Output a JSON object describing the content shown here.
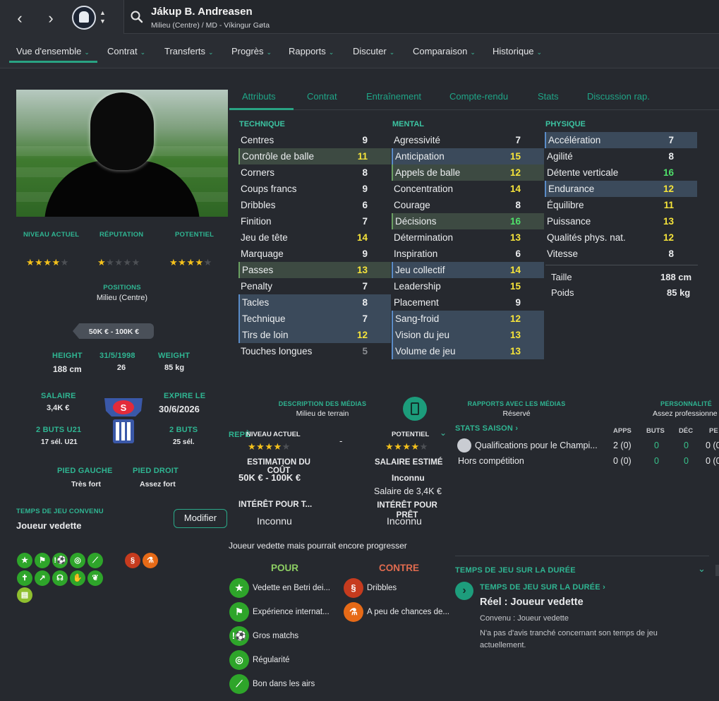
{
  "header": {
    "player_name": "Jákup B. Andreasen",
    "player_sub": "Milieu (Centre) / MD - Víkingur Gøta",
    "back_icon": "chevron-left-icon",
    "forward_icon": "chevron-right-icon"
  },
  "main_tabs": [
    {
      "label": "Vue d'ensemble"
    },
    {
      "label": "Contrat"
    },
    {
      "label": "Transferts"
    },
    {
      "label": "Progrès"
    },
    {
      "label": "Rapports"
    },
    {
      "label": "Discuter"
    },
    {
      "label": "Comparaison"
    },
    {
      "label": "Historique"
    }
  ],
  "profile": {
    "niveau_actuel_label": "NIVEAU ACTUEL",
    "reputation_label": "RÉPUTATION",
    "potentiel_label": "POTENTIEL",
    "niveau_actuel_stars": 4,
    "reputation_stars": 1,
    "potentiel_stars": 4,
    "positions_label": "POSITIONS",
    "positions_value": "Milieu (Centre)",
    "value_range": "50K € - 100K €",
    "height_label": "HEIGHT",
    "height_value": "188 cm",
    "dob_label": "31/5/1998",
    "age_value": "26",
    "weight_label": "WEIGHT",
    "weight_value": "85 kg",
    "salaire_label": "SALAIRE",
    "salaire_value": "3,4K €",
    "expire_label": "EXPIRE LE",
    "expire_value": "30/6/2026",
    "u21_label": "2 BUTS U21",
    "u21_value": "17 sél. U21",
    "buts_label": "2 BUTS",
    "buts_value": "25 sél.",
    "pied_gauche_label": "PIED GAUCHE",
    "pied_gauche_value": "Très fort",
    "pied_droit_label": "PIED DROIT",
    "pied_droit_value": "Assez fort",
    "temps_label": "TEMPS DE JEU CONVENU",
    "temps_value": "Joueur vedette",
    "modifier_label": "Modifier"
  },
  "sub_tabs": [
    {
      "label": "Attributs"
    },
    {
      "label": "Contrat"
    },
    {
      "label": "Entraînement"
    },
    {
      "label": "Compte-rendu"
    },
    {
      "label": "Stats"
    },
    {
      "label": "Discussion rap."
    }
  ],
  "attributes": {
    "technique_header": "TECHNIQUE",
    "mental_header": "MENTAL",
    "physique_header": "PHYSIQUE",
    "technique": [
      {
        "name": "Centres",
        "value": "9",
        "hl": "",
        "vc": "white"
      },
      {
        "name": "Contrôle de balle",
        "value": "11",
        "hl": "green",
        "vc": "yellow"
      },
      {
        "name": "Corners",
        "value": "8",
        "hl": "",
        "vc": "white"
      },
      {
        "name": "Coups francs",
        "value": "9",
        "hl": "",
        "vc": "white"
      },
      {
        "name": "Dribbles",
        "value": "6",
        "hl": "",
        "vc": "white"
      },
      {
        "name": "Finition",
        "value": "7",
        "hl": "",
        "vc": "white"
      },
      {
        "name": "Jeu de tête",
        "value": "14",
        "hl": "",
        "vc": "yellow"
      },
      {
        "name": "Marquage",
        "value": "9",
        "hl": "",
        "vc": "white"
      },
      {
        "name": "Passes",
        "value": "13",
        "hl": "green",
        "vc": "yellow"
      },
      {
        "name": "Penalty",
        "value": "7",
        "hl": "",
        "vc": "white"
      },
      {
        "name": "Tacles",
        "value": "8",
        "hl": "blue",
        "vc": "white"
      },
      {
        "name": "Technique",
        "value": "7",
        "hl": "blue",
        "vc": "white"
      },
      {
        "name": "Tirs de loin",
        "value": "12",
        "hl": "blue",
        "vc": "yellow"
      },
      {
        "name": "Touches longues",
        "value": "5",
        "hl": "",
        "vc": "grey"
      }
    ],
    "mental": [
      {
        "name": "Agressivité",
        "value": "7",
        "hl": "",
        "vc": "white"
      },
      {
        "name": "Anticipation",
        "value": "15",
        "hl": "blue",
        "vc": "yellow"
      },
      {
        "name": "Appels de balle",
        "value": "12",
        "hl": "green",
        "vc": "yellow"
      },
      {
        "name": "Concentration",
        "value": "14",
        "hl": "",
        "vc": "yellow"
      },
      {
        "name": "Courage",
        "value": "8",
        "hl": "",
        "vc": "white"
      },
      {
        "name": "Décisions",
        "value": "16",
        "hl": "green",
        "vc": "green"
      },
      {
        "name": "Détermination",
        "value": "13",
        "hl": "",
        "vc": "yellow"
      },
      {
        "name": "Inspiration",
        "value": "6",
        "hl": "",
        "vc": "white"
      },
      {
        "name": "Jeu collectif",
        "value": "14",
        "hl": "blue",
        "vc": "yellow"
      },
      {
        "name": "Leadership",
        "value": "15",
        "hl": "",
        "vc": "yellow"
      },
      {
        "name": "Placement",
        "value": "9",
        "hl": "",
        "vc": "white"
      },
      {
        "name": "Sang-froid",
        "value": "12",
        "hl": "blue",
        "vc": "yellow"
      },
      {
        "name": "Vision du jeu",
        "value": "13",
        "hl": "blue",
        "vc": "yellow"
      },
      {
        "name": "Volume de jeu",
        "value": "13",
        "hl": "blue",
        "vc": "yellow"
      }
    ],
    "physique": [
      {
        "name": "Accélération",
        "value": "7",
        "hl": "blue",
        "vc": "white"
      },
      {
        "name": "Agilité",
        "value": "8",
        "hl": "",
        "vc": "white"
      },
      {
        "name": "Détente verticale",
        "value": "16",
        "hl": "",
        "vc": "green"
      },
      {
        "name": "Endurance",
        "value": "12",
        "hl": "blue",
        "vc": "yellow"
      },
      {
        "name": "Équilibre",
        "value": "11",
        "hl": "",
        "vc": "yellow"
      },
      {
        "name": "Puissance",
        "value": "13",
        "hl": "",
        "vc": "yellow"
      },
      {
        "name": "Qualités phys. nat.",
        "value": "12",
        "hl": "",
        "vc": "yellow"
      },
      {
        "name": "Vitesse",
        "value": "8",
        "hl": "",
        "vc": "white"
      }
    ],
    "taille_label": "Taille",
    "taille_value": "188 cm",
    "poids_label": "Poids",
    "poids_value": "85 kg"
  },
  "media": {
    "desc_label": "DESCRIPTION DES MÉDIAS",
    "desc_value": "Milieu de terrain",
    "rapports_label": "RAPPORTS AVEC LES MÉDIAS",
    "rapports_value": "Réservé",
    "perso_label": "PERSONNALITÉ",
    "perso_value": "Assez professionne"
  },
  "report": {
    "repere_partial": "REPÈ",
    "niveau_label": "NIVEAU ACTUEL",
    "potentiel_label": "POTENTIEL",
    "niveau_stars": 4,
    "potentiel_stars": 4,
    "dash": "-",
    "estimation_label": "ESTIMATION DU COÛT",
    "estimation_value": "50K € - 100K €",
    "salaire_label": "SALAIRE ESTIMÉ",
    "salaire_value1": "Inconnu",
    "salaire_value2": "Salaire de 3,4K €",
    "interet_transfert_label": "INTÉRÊT POUR T...",
    "interet_transfert_value": "Inconnu",
    "interet_pret_label": "INTÉRÊT POUR PRÊT",
    "interet_pret_value": "Inconnu",
    "summary": "Joueur vedette mais pourrait encore progresser",
    "pour_label": "POUR",
    "contre_label": "CONTRE",
    "pour_items": [
      {
        "label": "Vedette en Betri dei...",
        "icon": "star-icon"
      },
      {
        "label": "Expérience internat...",
        "icon": "flag-icon"
      },
      {
        "label": "Gros matchs",
        "icon": "ball-exclaim-icon"
      },
      {
        "label": "Régularité",
        "icon": "target-icon"
      },
      {
        "label": "Bon dans les airs",
        "icon": "bandage-icon"
      }
    ],
    "contre_items": [
      {
        "label": "Dribbles",
        "icon": "dribble-icon"
      },
      {
        "label": "A peu de chances de...",
        "icon": "flask-icon"
      }
    ]
  },
  "stats": {
    "title": "STATS SAISON",
    "col_apps": "APPS",
    "col_buts": "BUTS",
    "col_dec": "DÉC",
    "col_pe": "PE",
    "rows": [
      {
        "comp": "Qualifications pour le Champi...",
        "apps": "2 (0)",
        "buts": "0",
        "dec": "0",
        "pe": "0 (0"
      },
      {
        "comp": "Hors compétition",
        "apps": "0 (0)",
        "buts": "0",
        "dec": "0",
        "pe": "0 (0"
      }
    ]
  },
  "playing_time": {
    "header": "TEMPS DE JEU SUR LA DURÉE",
    "sub_header": "TEMPS DE JEU SUR LA DURÉE",
    "reel": "Réel : Joueur vedette",
    "convenu": "Convenu :  Joueur vedette",
    "note": "N'a pas d'avis tranché concernant son temps de jeu actuellement."
  },
  "colors": {
    "accent": "#29a383",
    "yellow": "#f5e33a",
    "green": "#4fe06a",
    "bg": "#26292f"
  }
}
